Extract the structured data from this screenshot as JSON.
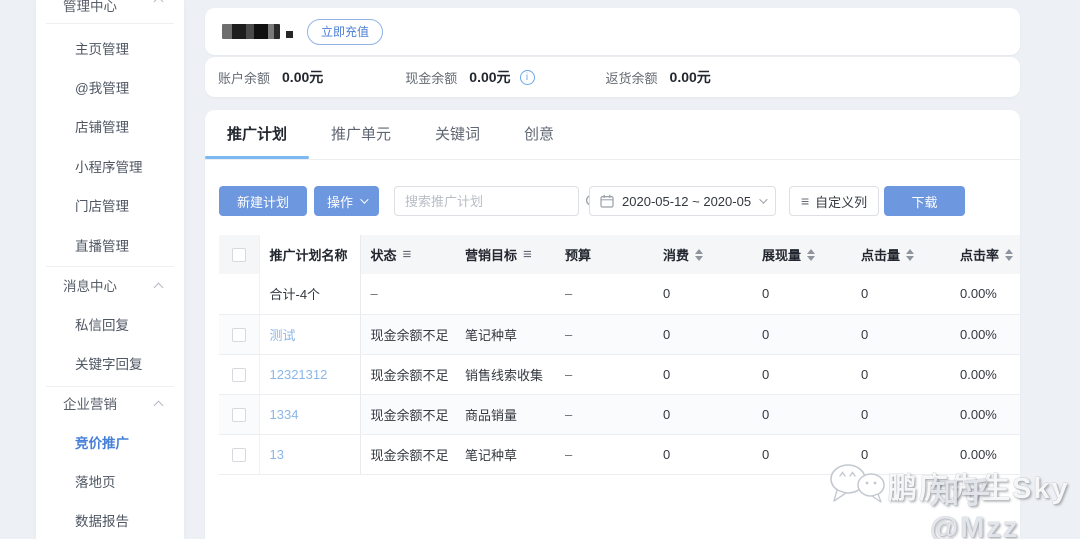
{
  "colors": {
    "primary_button": "#6d97de",
    "tab_underline": "#7cb8f2",
    "link_blue": "#8cb6e8",
    "sidebar_active": "#4680d9",
    "info_icon_blue": "#6aa6e8",
    "table_header_bg": "#f5f6f8",
    "page_bg": "#edf0f4"
  },
  "icons": {
    "info": "i",
    "filter": "≡",
    "custom_columns": "≡"
  },
  "sidebar": {
    "groups": [
      {
        "title": "管理中心",
        "items": [
          "主页管理",
          "@我管理",
          "店铺管理",
          "小程序管理",
          "门店管理",
          "直播管理"
        ]
      },
      {
        "title": "消息中心",
        "items": [
          "私信回复",
          "关键字回复"
        ]
      },
      {
        "title": "企业营销",
        "items": [
          "竞价推广",
          "落地页",
          "数据报告"
        ]
      }
    ],
    "active_item": "竞价推广"
  },
  "account": {
    "recharge_label": "立即充值"
  },
  "balance": {
    "items": [
      {
        "label": "账户余额",
        "value": "0.00元"
      },
      {
        "label": "现金余额",
        "value": "0.00元"
      },
      {
        "label": "返货余额",
        "value": "0.00元"
      }
    ]
  },
  "tabs": [
    {
      "label": "推广计划",
      "active": true
    },
    {
      "label": "推广单元",
      "active": false
    },
    {
      "label": "关键词",
      "active": false
    },
    {
      "label": "创意",
      "active": false
    }
  ],
  "toolbar": {
    "new_plan_label": "新建计划",
    "action_label": "操作",
    "search_placeholder": "搜索推广计划",
    "date_range": "2020-05-12 ~ 2020-05",
    "custom_columns_label": "自定义列",
    "download_label": "下载"
  },
  "table": {
    "columns": {
      "name": "推广计划名称",
      "status": "状态",
      "goal": "营销目标",
      "budget": "预算",
      "cost": "消费",
      "impressions": "展现量",
      "clicks": "点击量",
      "ctr": "点击率"
    },
    "rows": [
      {
        "name": "合计-4个",
        "status": "–",
        "goal": "",
        "budget": "–",
        "cost": "0",
        "impressions": "0",
        "clicks": "0",
        "ctr": "0.00%"
      },
      {
        "name": "测试",
        "status": "现金余额不足",
        "goal": "笔记种草",
        "budget": "–",
        "cost": "0",
        "impressions": "0",
        "clicks": "0",
        "ctr": "0.00%"
      },
      {
        "name": "12321312",
        "status": "现金余额不足",
        "goal": "销售线索收集",
        "budget": "–",
        "cost": "0",
        "impressions": "0",
        "clicks": "0",
        "ctr": "0.00%"
      },
      {
        "name": "1334",
        "status": "现金余额不足",
        "goal": "商品销量",
        "budget": "–",
        "cost": "0",
        "impressions": "0",
        "clicks": "0",
        "ctr": "0.00%"
      },
      {
        "name": "13",
        "status": "现金余额不足",
        "goal": "笔记种草",
        "budget": "–",
        "cost": "0",
        "impressions": "0",
        "clicks": "0",
        "ctr": "0.00%"
      }
    ]
  },
  "watermark": {
    "wechat_text": "鹏庐先生Sky",
    "zhihu_text": "知乎 @Mzz"
  }
}
